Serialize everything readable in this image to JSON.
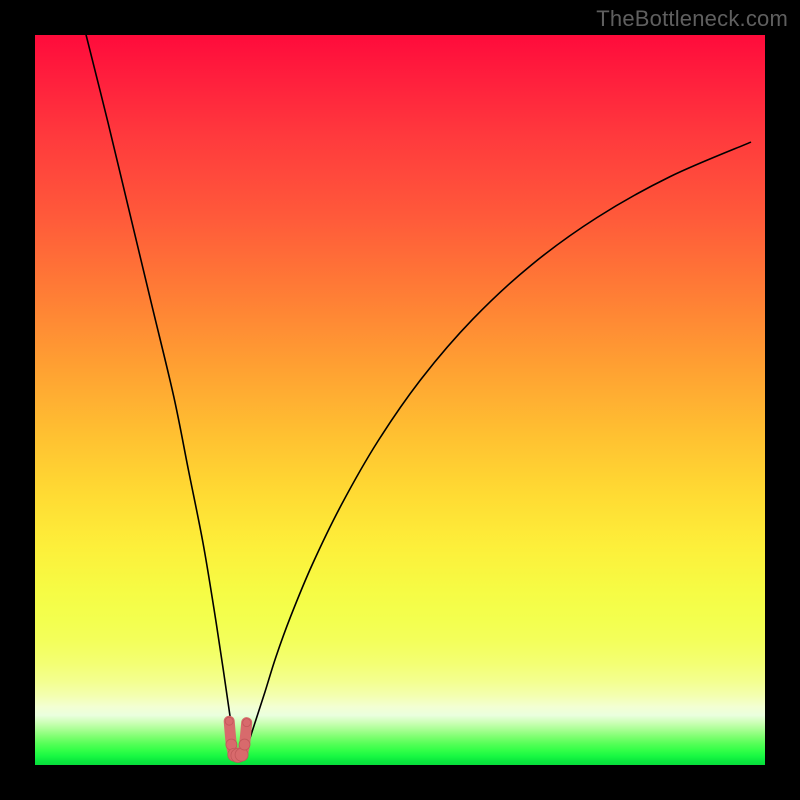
{
  "watermark": "TheBottleneck.com",
  "colors": {
    "page_bg": "#000000",
    "curve": "#000000",
    "marker_fill": "#d86a6c",
    "marker_stroke": "#c2575a"
  },
  "chart_data": {
    "type": "line",
    "title": "",
    "xlabel": "",
    "ylabel": "",
    "xlim": [
      0,
      100
    ],
    "ylim": [
      0,
      100
    ],
    "grid": false,
    "legend": false,
    "annotations": [],
    "series": [
      {
        "name": "bottleneck-curve",
        "x": [
          7,
          10,
          13,
          16,
          19,
          21,
          23,
          24.5,
          25.8,
          26.7,
          27.3,
          27.8,
          28.4,
          29.2,
          30.2,
          31.5,
          33,
          35,
          38,
          42,
          47,
          53,
          60,
          68,
          77,
          87,
          98
        ],
        "y": [
          100,
          88,
          75.5,
          63,
          50.5,
          40.5,
          30.5,
          21.5,
          13,
          6.8,
          3.1,
          1.5,
          1.5,
          3.0,
          6.0,
          10.0,
          14.8,
          20.3,
          27.5,
          35.7,
          44.4,
          53.0,
          61.1,
          68.5,
          75.0,
          80.6,
          85.3
        ]
      }
    ],
    "markers": {
      "name": "valley-markers",
      "x": [
        26.6,
        26.9,
        27.3,
        27.8,
        28.3,
        28.7,
        29.0
      ],
      "y": [
        6.0,
        2.8,
        1.4,
        1.3,
        1.4,
        2.8,
        5.8
      ],
      "size_sequence": [
        4,
        5.5,
        6.5,
        7,
        6.5,
        5.5,
        4
      ]
    }
  }
}
